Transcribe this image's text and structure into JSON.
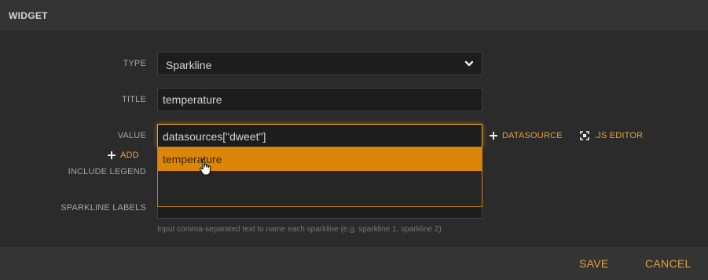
{
  "header": {
    "title": "WIDGET"
  },
  "form": {
    "type": {
      "label": "TYPE",
      "selected": "Sparkline"
    },
    "title": {
      "label": "TITLE",
      "value": "temperature"
    },
    "value": {
      "label": "VALUE",
      "value": "datasources[\"dweet\"]",
      "datasource_link": "DATASOURCE",
      "js_editor_link": ".JS EDITOR",
      "add_link": "ADD",
      "suggestions": [
        "temperature"
      ]
    },
    "include_legend": {
      "label": "INCLUDE LEGEND"
    },
    "sparkline_labels": {
      "label": "SPARKLINE LABELS",
      "hint": "Input comma-separated text to name each sparkline (e.g. sparkline 1, sparkline 2)"
    }
  },
  "footer": {
    "save_label": "SAVE",
    "cancel_label": "CANCEL"
  },
  "colors": {
    "accent": "#e3a23b",
    "highlight": "#dc8609",
    "background": "#2b2b2b"
  }
}
